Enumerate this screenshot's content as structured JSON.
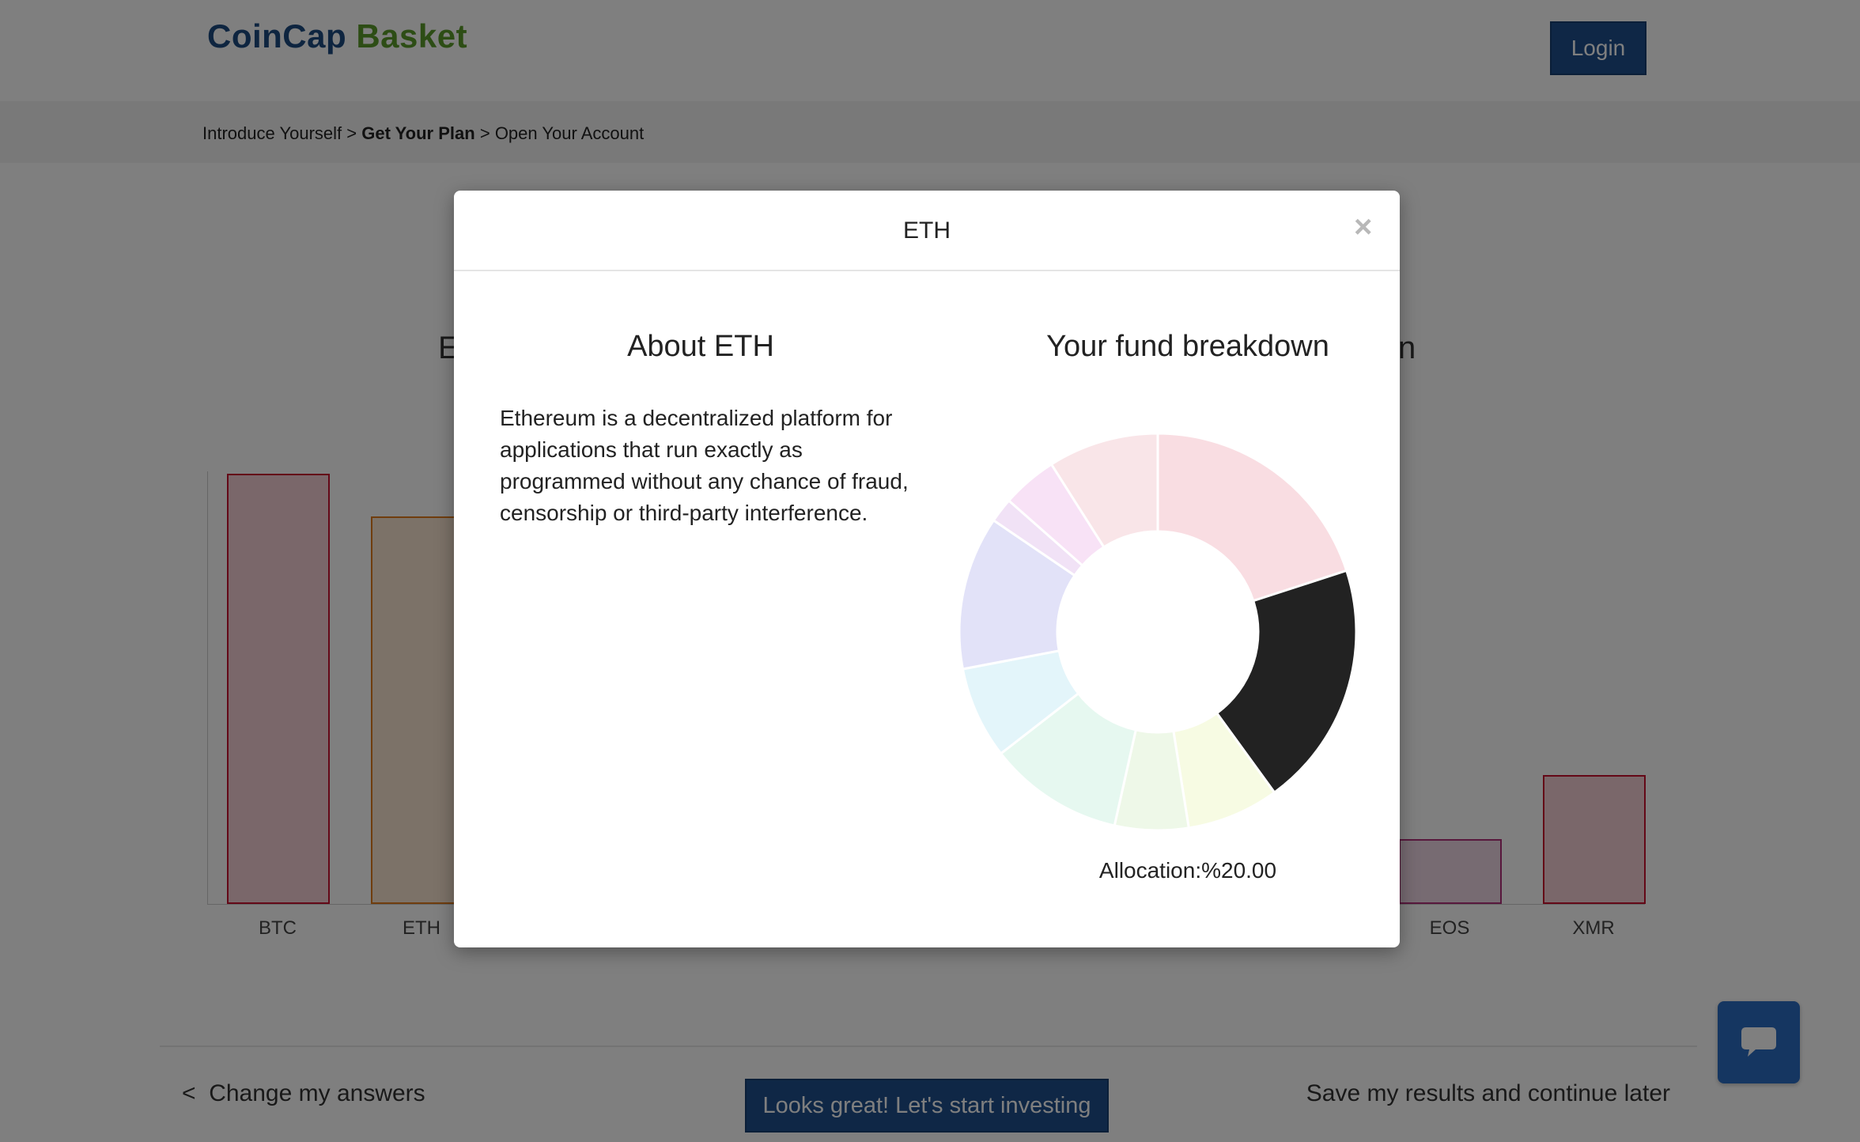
{
  "header": {
    "logo_part1": "CoinCap",
    "logo_part2": "Basket",
    "login_label": "Login"
  },
  "breadcrumb": {
    "step1": "Introduce Yourself",
    "sep1": ">",
    "step2": "Get Your Plan",
    "sep2": ">",
    "step3": "Open Your Account"
  },
  "background_page": {
    "heading_left_fragment": "E",
    "heading_right_fragment": "n",
    "bar_labels": [
      "BTC",
      "ETH",
      "EOS",
      "XMR"
    ]
  },
  "chart_data": {
    "type": "bar",
    "categories": [
      "BTC",
      "ETH",
      "EOS",
      "XMR"
    ],
    "values": [
      100,
      90,
      15,
      30
    ],
    "colors": [
      "#c8102e",
      "#e07b1a",
      "#b0307a",
      "#c8102e"
    ]
  },
  "footer": {
    "back_arrow": "<",
    "back_label": "Change my answers",
    "invest_label": "Looks great! Let's start investing",
    "save_label": "Save my results and continue later"
  },
  "modal": {
    "title": "ETH",
    "close_symbol": "×",
    "about_title": "About ETH",
    "about_text": "Ethereum is a decentralized platform for applications that run exactly as programmed without any chance of fraud, censorship or third-party interference.",
    "fund_title": "Your fund breakdown",
    "allocation_text": "Allocation:%20.00",
    "donut": {
      "segments": [
        {
          "fraction": 0.2,
          "color": "#f9dde2",
          "highlighted": false
        },
        {
          "fraction": 0.2,
          "color": "#222222",
          "highlighted": true
        },
        {
          "fraction": 0.075,
          "color": "#f7fbe3",
          "highlighted": false
        },
        {
          "fraction": 0.06,
          "color": "#eef8e8",
          "highlighted": false
        },
        {
          "fraction": 0.11,
          "color": "#e6f8f0",
          "highlighted": false
        },
        {
          "fraction": 0.075,
          "color": "#e3f5fa",
          "highlighted": false
        },
        {
          "fraction": 0.125,
          "color": "#e2e2f8",
          "highlighted": false
        },
        {
          "fraction": 0.02,
          "color": "#f1e2f6",
          "highlighted": false
        },
        {
          "fraction": 0.045,
          "color": "#f8e2f6",
          "highlighted": false
        },
        {
          "fraction": 0.09,
          "color": "#f9e5e8",
          "highlighted": false
        }
      ]
    }
  },
  "chat": {
    "icon": "chat-bubble-icon"
  }
}
